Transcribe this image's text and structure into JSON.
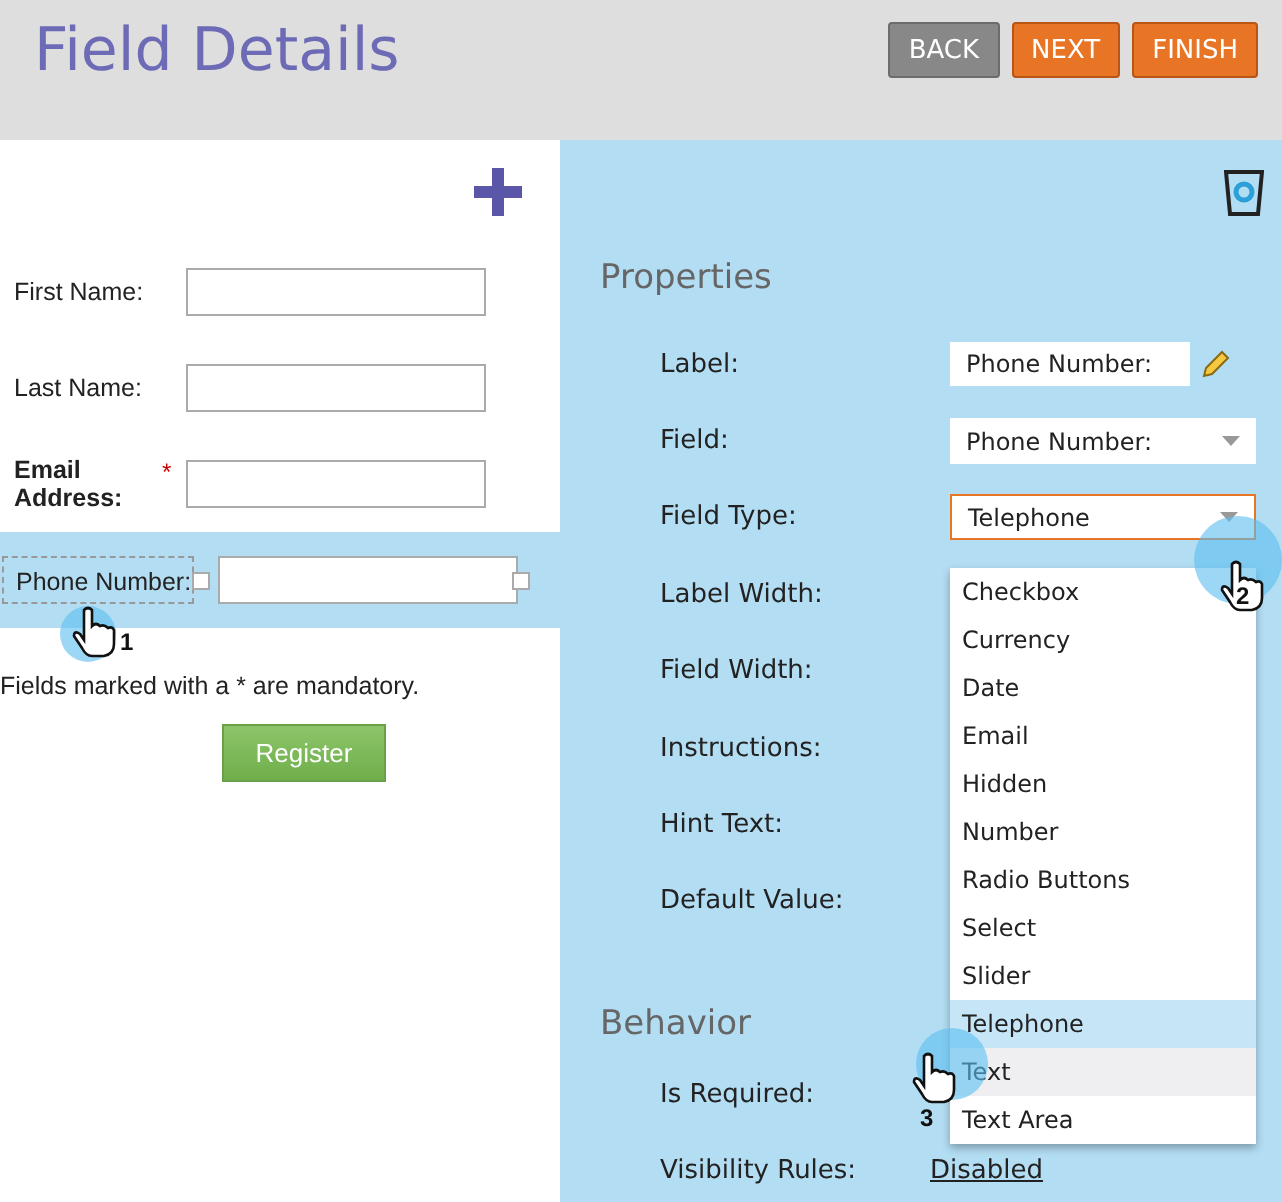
{
  "header": {
    "title": "Field Details",
    "buttons": [
      {
        "label": "BACK",
        "kind": "secondary"
      },
      {
        "label": "NEXT",
        "kind": "primary"
      },
      {
        "label": "FINISH",
        "kind": "primary"
      }
    ]
  },
  "form": {
    "fields": [
      {
        "label": "First Name:",
        "required": false,
        "selected": false
      },
      {
        "label": "Last Name:",
        "required": false,
        "selected": false
      },
      {
        "label": "Email Address:",
        "required": true,
        "required_mark": "*",
        "selected": false
      },
      {
        "label": "Phone Number:",
        "required": false,
        "selected": true
      }
    ],
    "note": "Fields marked with a * are mandatory.",
    "submit": "Register"
  },
  "properties": {
    "title": "Properties",
    "rows": [
      {
        "label": "Label:",
        "kind": "text",
        "value": "Phone Number:"
      },
      {
        "label": "Field:",
        "kind": "select",
        "value": "Phone Number:"
      },
      {
        "label": "Field Type:",
        "kind": "open-select",
        "value": "Telephone"
      },
      {
        "label": "Label Width:",
        "kind": "none"
      },
      {
        "label": "Field Width:",
        "kind": "none"
      },
      {
        "label": "Instructions:",
        "kind": "none"
      },
      {
        "label": "Hint Text:",
        "kind": "none"
      },
      {
        "label": "Default Value:",
        "kind": "none"
      }
    ]
  },
  "behavior": {
    "title": "Behavior",
    "rows": [
      {
        "label": "Is Required:",
        "kind": "none"
      },
      {
        "label": "Visibility Rules:",
        "kind": "link",
        "value": "Disabled"
      }
    ]
  },
  "dropdown": {
    "options": [
      {
        "label": "Checkbox",
        "selected": false,
        "hovered": false
      },
      {
        "label": "Currency",
        "selected": false,
        "hovered": false
      },
      {
        "label": "Date",
        "selected": false,
        "hovered": false
      },
      {
        "label": "Email",
        "selected": false,
        "hovered": false
      },
      {
        "label": "Hidden",
        "selected": false,
        "hovered": false
      },
      {
        "label": "Number",
        "selected": false,
        "hovered": false
      },
      {
        "label": "Radio Buttons",
        "selected": false,
        "hovered": false
      },
      {
        "label": "Select",
        "selected": false,
        "hovered": false
      },
      {
        "label": "Slider",
        "selected": false,
        "hovered": false
      },
      {
        "label": "Telephone",
        "selected": true,
        "hovered": false
      },
      {
        "label": "Text",
        "selected": false,
        "hovered": true
      },
      {
        "label": "Text Area",
        "selected": false,
        "hovered": false
      }
    ]
  },
  "steps": [
    "1",
    "2",
    "3"
  ]
}
